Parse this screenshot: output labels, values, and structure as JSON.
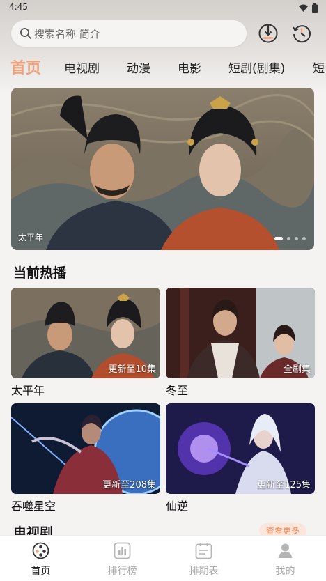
{
  "status_bar": {
    "time": "4:45"
  },
  "search": {
    "placeholder": "搜索名称 简介"
  },
  "top_actions": {
    "download_icon": "download-icon",
    "history_icon": "history-icon"
  },
  "tabs": [
    {
      "label": "首页",
      "active": true
    },
    {
      "label": "电视剧"
    },
    {
      "label": "动漫"
    },
    {
      "label": "电影"
    },
    {
      "label": "短剧(剧集)"
    },
    {
      "label": "短"
    }
  ],
  "banner": {
    "caption": "太平年",
    "total_slides": 4,
    "current_slide": 1
  },
  "hot_section": {
    "title": "当前热播",
    "items": [
      {
        "title": "太平年",
        "badge": "更新至10集"
      },
      {
        "title": "冬至",
        "badge": "全剧集"
      },
      {
        "title": "吞噬星空",
        "badge": "更新至208集"
      },
      {
        "title": "仙逆",
        "badge": "更新至125集"
      }
    ]
  },
  "tv_section": {
    "title": "电视剧",
    "more_label": "查看更多"
  },
  "bottom_nav": [
    {
      "label": "首页",
      "icon": "film-reel-icon",
      "active": true
    },
    {
      "label": "排行榜",
      "icon": "bar-chart-icon"
    },
    {
      "label": "排期表",
      "icon": "calendar-icon"
    },
    {
      "label": "我的",
      "icon": "user-icon"
    }
  ],
  "colors": {
    "accent": "#f0a07a",
    "more_text": "#f08b5f",
    "more_bg": "#fbe6dc"
  }
}
